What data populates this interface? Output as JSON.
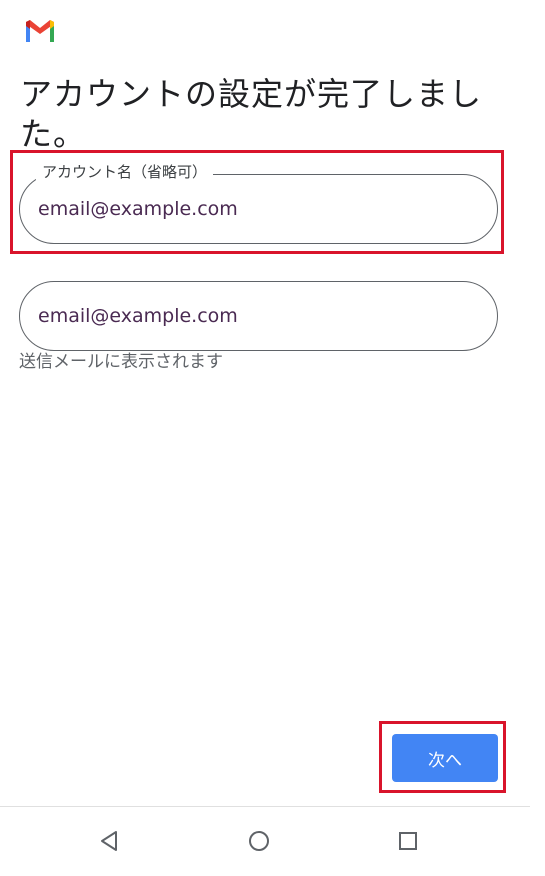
{
  "app": {
    "logo_icon": "gmail-m-icon",
    "colors": {
      "red": "#ea4335",
      "blue": "#4285f4",
      "yellow": "#fbbc04",
      "green": "#34a853",
      "highlight": "#d9142b"
    }
  },
  "page": {
    "title": "アカウントの設定が完了しました。"
  },
  "form": {
    "account_name": {
      "label": "アカウント名（省略可）",
      "value": "email@example.com"
    },
    "sender_name": {
      "value": "email@example.com",
      "helper": "送信メールに表示されます"
    }
  },
  "actions": {
    "next_label": "次へ"
  },
  "system_nav": {
    "back": "back-triangle-icon",
    "home": "home-circle-icon",
    "recents": "recents-square-icon"
  }
}
